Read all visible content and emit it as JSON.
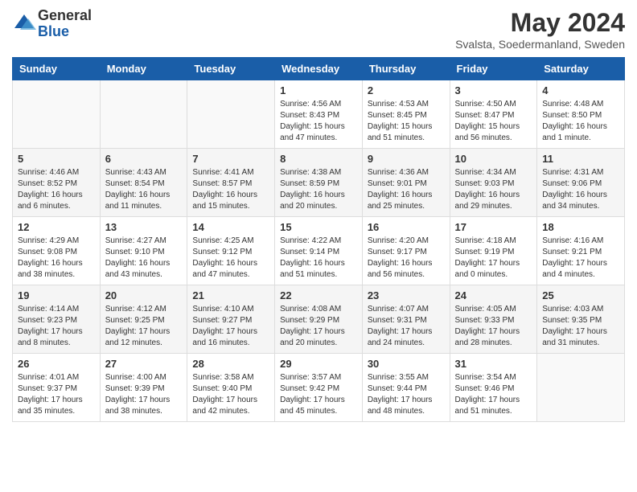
{
  "header": {
    "logo_general": "General",
    "logo_blue": "Blue",
    "month_title": "May 2024",
    "subtitle": "Svalsta, Soedermanland, Sweden"
  },
  "calendar": {
    "days_of_week": [
      "Sunday",
      "Monday",
      "Tuesday",
      "Wednesday",
      "Thursday",
      "Friday",
      "Saturday"
    ],
    "weeks": [
      [
        {
          "day": "",
          "info": ""
        },
        {
          "day": "",
          "info": ""
        },
        {
          "day": "",
          "info": ""
        },
        {
          "day": "1",
          "info": "Sunrise: 4:56 AM\nSunset: 8:43 PM\nDaylight: 15 hours and 47 minutes."
        },
        {
          "day": "2",
          "info": "Sunrise: 4:53 AM\nSunset: 8:45 PM\nDaylight: 15 hours and 51 minutes."
        },
        {
          "day": "3",
          "info": "Sunrise: 4:50 AM\nSunset: 8:47 PM\nDaylight: 15 hours and 56 minutes."
        },
        {
          "day": "4",
          "info": "Sunrise: 4:48 AM\nSunset: 8:50 PM\nDaylight: 16 hours and 1 minute."
        }
      ],
      [
        {
          "day": "5",
          "info": "Sunrise: 4:46 AM\nSunset: 8:52 PM\nDaylight: 16 hours and 6 minutes."
        },
        {
          "day": "6",
          "info": "Sunrise: 4:43 AM\nSunset: 8:54 PM\nDaylight: 16 hours and 11 minutes."
        },
        {
          "day": "7",
          "info": "Sunrise: 4:41 AM\nSunset: 8:57 PM\nDaylight: 16 hours and 15 minutes."
        },
        {
          "day": "8",
          "info": "Sunrise: 4:38 AM\nSunset: 8:59 PM\nDaylight: 16 hours and 20 minutes."
        },
        {
          "day": "9",
          "info": "Sunrise: 4:36 AM\nSunset: 9:01 PM\nDaylight: 16 hours and 25 minutes."
        },
        {
          "day": "10",
          "info": "Sunrise: 4:34 AM\nSunset: 9:03 PM\nDaylight: 16 hours and 29 minutes."
        },
        {
          "day": "11",
          "info": "Sunrise: 4:31 AM\nSunset: 9:06 PM\nDaylight: 16 hours and 34 minutes."
        }
      ],
      [
        {
          "day": "12",
          "info": "Sunrise: 4:29 AM\nSunset: 9:08 PM\nDaylight: 16 hours and 38 minutes."
        },
        {
          "day": "13",
          "info": "Sunrise: 4:27 AM\nSunset: 9:10 PM\nDaylight: 16 hours and 43 minutes."
        },
        {
          "day": "14",
          "info": "Sunrise: 4:25 AM\nSunset: 9:12 PM\nDaylight: 16 hours and 47 minutes."
        },
        {
          "day": "15",
          "info": "Sunrise: 4:22 AM\nSunset: 9:14 PM\nDaylight: 16 hours and 51 minutes."
        },
        {
          "day": "16",
          "info": "Sunrise: 4:20 AM\nSunset: 9:17 PM\nDaylight: 16 hours and 56 minutes."
        },
        {
          "day": "17",
          "info": "Sunrise: 4:18 AM\nSunset: 9:19 PM\nDaylight: 17 hours and 0 minutes."
        },
        {
          "day": "18",
          "info": "Sunrise: 4:16 AM\nSunset: 9:21 PM\nDaylight: 17 hours and 4 minutes."
        }
      ],
      [
        {
          "day": "19",
          "info": "Sunrise: 4:14 AM\nSunset: 9:23 PM\nDaylight: 17 hours and 8 minutes."
        },
        {
          "day": "20",
          "info": "Sunrise: 4:12 AM\nSunset: 9:25 PM\nDaylight: 17 hours and 12 minutes."
        },
        {
          "day": "21",
          "info": "Sunrise: 4:10 AM\nSunset: 9:27 PM\nDaylight: 17 hours and 16 minutes."
        },
        {
          "day": "22",
          "info": "Sunrise: 4:08 AM\nSunset: 9:29 PM\nDaylight: 17 hours and 20 minutes."
        },
        {
          "day": "23",
          "info": "Sunrise: 4:07 AM\nSunset: 9:31 PM\nDaylight: 17 hours and 24 minutes."
        },
        {
          "day": "24",
          "info": "Sunrise: 4:05 AM\nSunset: 9:33 PM\nDaylight: 17 hours and 28 minutes."
        },
        {
          "day": "25",
          "info": "Sunrise: 4:03 AM\nSunset: 9:35 PM\nDaylight: 17 hours and 31 minutes."
        }
      ],
      [
        {
          "day": "26",
          "info": "Sunrise: 4:01 AM\nSunset: 9:37 PM\nDaylight: 17 hours and 35 minutes."
        },
        {
          "day": "27",
          "info": "Sunrise: 4:00 AM\nSunset: 9:39 PM\nDaylight: 17 hours and 38 minutes."
        },
        {
          "day": "28",
          "info": "Sunrise: 3:58 AM\nSunset: 9:40 PM\nDaylight: 17 hours and 42 minutes."
        },
        {
          "day": "29",
          "info": "Sunrise: 3:57 AM\nSunset: 9:42 PM\nDaylight: 17 hours and 45 minutes."
        },
        {
          "day": "30",
          "info": "Sunrise: 3:55 AM\nSunset: 9:44 PM\nDaylight: 17 hours and 48 minutes."
        },
        {
          "day": "31",
          "info": "Sunrise: 3:54 AM\nSunset: 9:46 PM\nDaylight: 17 hours and 51 minutes."
        },
        {
          "day": "",
          "info": ""
        }
      ]
    ]
  }
}
